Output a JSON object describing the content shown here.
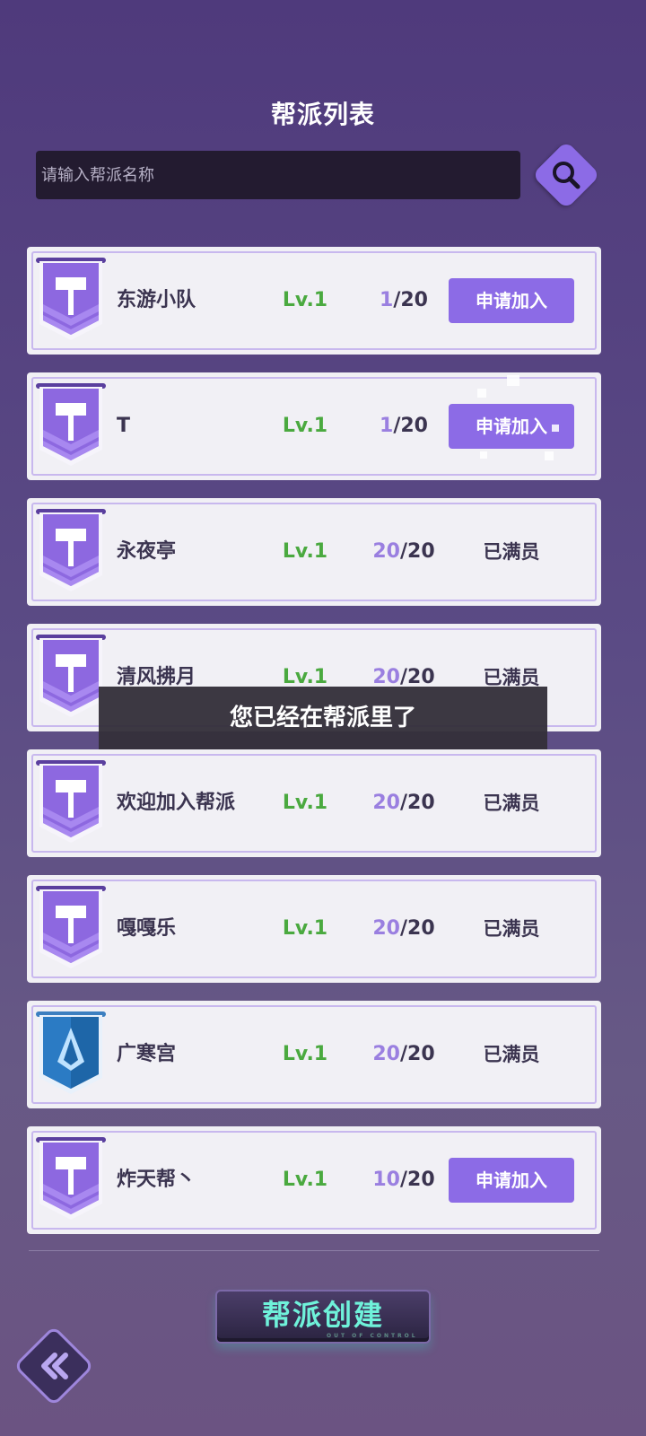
{
  "header": {
    "title": "帮派列表"
  },
  "search": {
    "placeholder": "请输入帮派名称",
    "button_icon": "search-icon"
  },
  "guilds": [
    {
      "name": "东游小队",
      "level": "Lv.1",
      "current": "1",
      "max": "/20",
      "action": "申请加入",
      "emblem": "hammer-banner"
    },
    {
      "name": "T",
      "level": "Lv.1",
      "current": "1",
      "max": "/20",
      "action": "申请加入",
      "emblem": "hammer-banner"
    },
    {
      "name": "永夜亭",
      "level": "Lv.1",
      "current": "20",
      "max": "/20",
      "action": "已满员",
      "emblem": "hammer-banner"
    },
    {
      "name": "清风拂月",
      "level": "Lv.1",
      "current": "20",
      "max": "/20",
      "action": "已满员",
      "emblem": "hammer-banner"
    },
    {
      "name": "欢迎加入帮派",
      "level": "Lv.1",
      "current": "20",
      "max": "/20",
      "action": "已满员",
      "emblem": "hammer-banner"
    },
    {
      "name": "嘎嘎乐",
      "level": "Lv.1",
      "current": "20",
      "max": "/20",
      "action": "已满员",
      "emblem": "hammer-banner"
    },
    {
      "name": "广寒宫",
      "level": "Lv.1",
      "current": "20",
      "max": "/20",
      "action": "已满员",
      "emblem": "crystal-banner"
    },
    {
      "name": "炸天帮丶",
      "level": "Lv.1",
      "current": "10",
      "max": "/20",
      "action": "申请加入",
      "emblem": "hammer-banner"
    }
  ],
  "toast": {
    "message": "您已经在帮派里了"
  },
  "footer": {
    "create_label": "帮派创建",
    "create_sub": "OUT OF CONTROL",
    "back_icon": "double-chevron-left-icon"
  },
  "colors": {
    "accent": "#8c6be6",
    "level": "#4aa93f",
    "member_current": "#9a7fe0",
    "create_text": "#6ff2da"
  }
}
